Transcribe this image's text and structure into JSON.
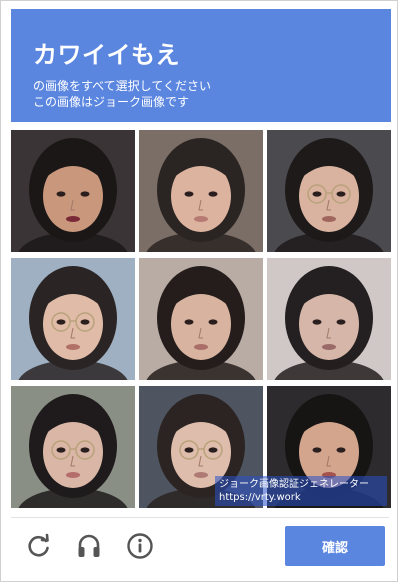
{
  "header": {
    "title": "カワイイもえ",
    "line1": "の画像をすべて選択してください",
    "line2": "この画像はジョーク画像です"
  },
  "grid": {
    "rows": 3,
    "cols": 3,
    "tiles": [
      {
        "label": "tile-1",
        "skin": "#c9977c",
        "hair": "#1c1717",
        "bg": "#3b3436",
        "lip": "#7a2a36",
        "glasses": false
      },
      {
        "label": "tile-2",
        "skin": "#dcb39e",
        "hair": "#2a2422",
        "bg": "#7a6e66",
        "lip": "#b77a72",
        "glasses": false
      },
      {
        "label": "tile-3",
        "skin": "#d9b39f",
        "hair": "#1e1a1a",
        "bg": "#4a4a4f",
        "lip": "#a0665e",
        "glasses": true
      },
      {
        "label": "tile-4",
        "skin": "#e0bca8",
        "hair": "#2a2424",
        "bg": "#9fb0c2",
        "lip": "#b07066",
        "glasses": true
      },
      {
        "label": "tile-5",
        "skin": "#d8b4a0",
        "hair": "#241d1c",
        "bg": "#b8aca4",
        "lip": "#a96e68",
        "glasses": false
      },
      {
        "label": "tile-6",
        "skin": "#d6b6a8",
        "hair": "#241f20",
        "bg": "#cfc8c6",
        "lip": "#9a6a68",
        "glasses": false
      },
      {
        "label": "tile-7",
        "skin": "#d9b6a6",
        "hair": "#1f1b1c",
        "bg": "#8a8f86",
        "lip": "#b46d6a",
        "glasses": true
      },
      {
        "label": "tile-8",
        "skin": "#dfbdac",
        "hair": "#2b2422",
        "bg": "#4e5560",
        "lip": "#b07a74",
        "glasses": true
      },
      {
        "label": "tile-9",
        "skin": "#d3a58d",
        "hair": "#171414",
        "bg": "#2d2b2e",
        "lip": "#a3524c",
        "glasses": false
      }
    ]
  },
  "watermark": {
    "line1": "ジョーク画像認証ジェネレーター",
    "line2": "https://vrty.work"
  },
  "footer": {
    "verify_label": "確認",
    "icons": [
      "refresh-icon",
      "headphones-icon",
      "info-icon"
    ]
  },
  "colors": {
    "accent": "#5b86e0",
    "icon": "#555555"
  }
}
